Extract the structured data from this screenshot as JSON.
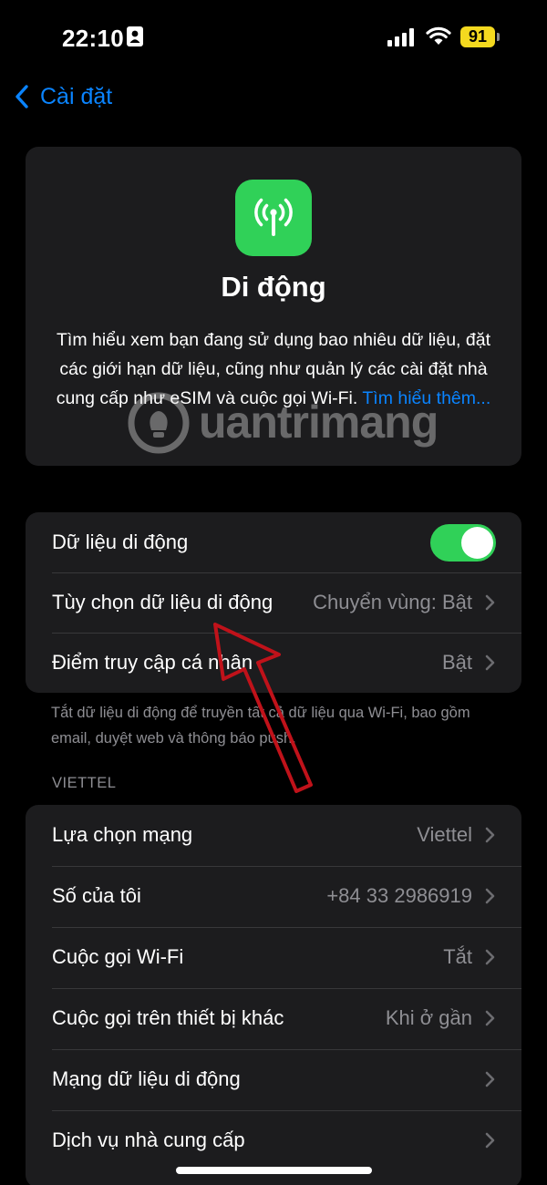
{
  "status": {
    "time": "22:10",
    "battery": "91"
  },
  "nav": {
    "back_label": "Cài đặt"
  },
  "hero": {
    "title": "Di động",
    "description": "Tìm hiểu xem bạn đang sử dụng bao nhiêu dữ liệu, đặt các giới hạn dữ liệu, cũng như quản lý các cài đặt nhà cung cấp như eSIM và cuộc gọi Wi-Fi.",
    "learn_more": "Tìm hiểu thêm..."
  },
  "group1": {
    "rows": [
      {
        "label": "Dữ liệu di động",
        "toggle": "on"
      },
      {
        "label": "Tùy chọn dữ liệu di động",
        "value": "Chuyển vùng: Bật"
      },
      {
        "label": "Điểm truy cập cá nhân",
        "value": "Bật"
      }
    ],
    "footer": "Tắt dữ liệu di động để truyền tất cả dữ liệu qua Wi-Fi, bao gồm email, duyệt web và thông báo push."
  },
  "section2": {
    "header": "VIETTEL",
    "rows": [
      {
        "label": "Lựa chọn mạng",
        "value": "Viettel"
      },
      {
        "label": "Số của tôi",
        "value": "+84 33 2986919"
      },
      {
        "label": "Cuộc gọi Wi-Fi",
        "value": "Tắt"
      },
      {
        "label": "Cuộc gọi trên thiết bị khác",
        "value": "Khi ở gần"
      },
      {
        "label": "Mạng dữ liệu di động",
        "value": ""
      },
      {
        "label": "Dịch vụ nhà cung cấp",
        "value": ""
      }
    ]
  },
  "watermark": {
    "text": "uantrimang"
  },
  "icons": {
    "back": "chevron-left-icon",
    "app": "antenna-icon",
    "row": "chevron-right-icon"
  },
  "colors": {
    "accent": "#0a84ff",
    "toggle_on": "#30d158",
    "battery": "#f4d91f",
    "arrow": "#c0121a"
  }
}
